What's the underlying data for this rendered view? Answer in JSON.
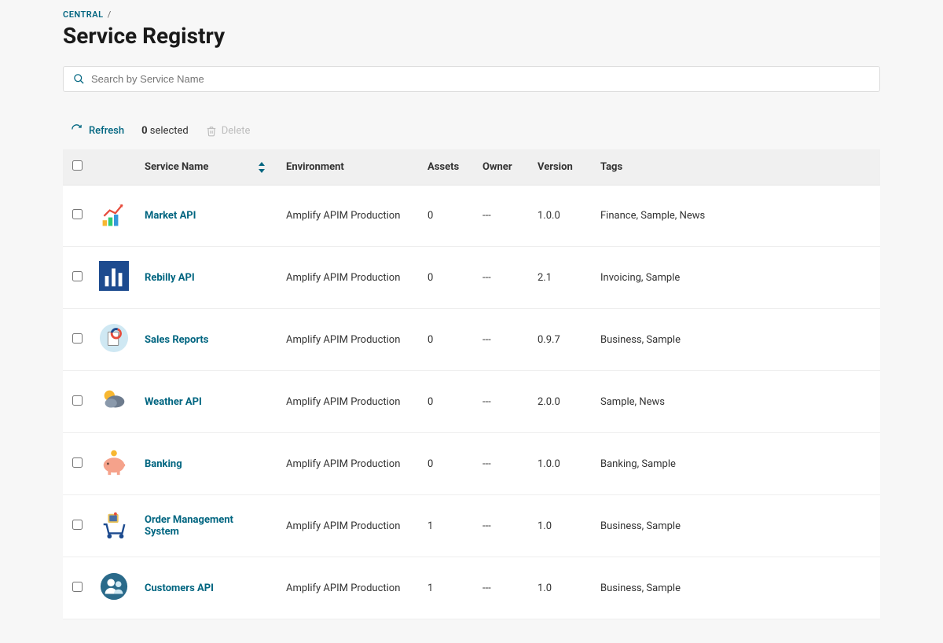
{
  "breadcrumb": {
    "parent": "CENTRAL",
    "sep": "/"
  },
  "page_title": "Service Registry",
  "search": {
    "placeholder": "Search by Service Name"
  },
  "toolbar": {
    "refresh": "Refresh",
    "selected_count": "0",
    "selected_suffix": " selected",
    "delete": "Delete"
  },
  "columns": {
    "service_name": "Service Name",
    "environment": "Environment",
    "assets": "Assets",
    "owner": "Owner",
    "version": "Version",
    "tags": "Tags"
  },
  "rows": [
    {
      "name": "Market API",
      "environment": "Amplify APIM Production",
      "assets": "0",
      "owner": "---",
      "version": "1.0.0",
      "tags": "Finance, Sample, News",
      "icon": "chart-up"
    },
    {
      "name": "Rebilly API",
      "environment": "Amplify APIM Production",
      "assets": "0",
      "owner": "---",
      "version": "2.1",
      "tags": "Invoicing, Sample",
      "icon": "bar-chart"
    },
    {
      "name": "Sales Reports",
      "environment": "Amplify APIM Production",
      "assets": "0",
      "owner": "---",
      "version": "0.9.7",
      "tags": "Business, Sample",
      "icon": "report-doc"
    },
    {
      "name": "Weather API",
      "environment": "Amplify APIM Production",
      "assets": "0",
      "owner": "---",
      "version": "2.0.0",
      "tags": "Sample, News",
      "icon": "weather"
    },
    {
      "name": "Banking",
      "environment": "Amplify APIM Production",
      "assets": "0",
      "owner": "---",
      "version": "1.0.0",
      "tags": "Banking, Sample",
      "icon": "piggy-bank"
    },
    {
      "name": "Order Management System",
      "environment": "Amplify APIM Production",
      "assets": "1",
      "owner": "---",
      "version": "1.0",
      "tags": "Business, Sample",
      "icon": "shopping-cart"
    },
    {
      "name": "Customers API",
      "environment": "Amplify APIM Production",
      "assets": "1",
      "owner": "---",
      "version": "1.0",
      "tags": "Business, Sample",
      "icon": "users"
    }
  ]
}
